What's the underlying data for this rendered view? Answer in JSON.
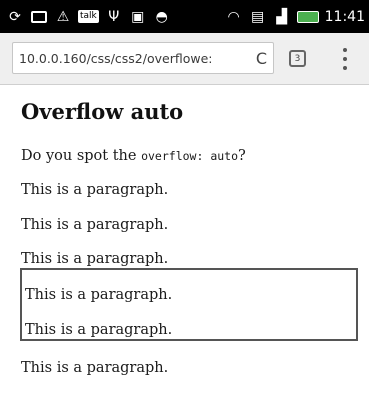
{
  "status_bar": {
    "time": "11:41",
    "icons": [
      "sync-icon",
      "message-icon",
      "warning-icon",
      "talk-icon",
      "usb-icon",
      "camera-icon",
      "game-icon",
      "wifi-icon",
      "sim-icon",
      "signal-icon",
      "battery-icon"
    ],
    "talk_label": "talk"
  },
  "browser": {
    "url": "10.0.0.160/css/css2/overflowe:",
    "tab_count": "3",
    "reload_glyph": "C"
  },
  "page": {
    "title": "Overflow auto",
    "intro_before": "Do you spot the ",
    "intro_code": "overflow: auto",
    "intro_after": "?",
    "paragraphs": [
      "This is a paragraph.",
      "This is a paragraph.",
      "This is a paragraph."
    ],
    "box_paragraphs": [
      "This is a paragraph.",
      "This is a paragraph."
    ],
    "after_box": "This is a paragraph."
  }
}
